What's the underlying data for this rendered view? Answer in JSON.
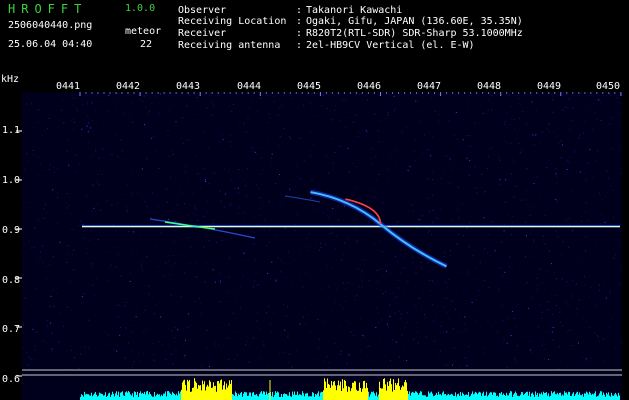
{
  "header": {
    "title": "HROFFT",
    "version": "1.0.0",
    "filename": "2506040440.png",
    "datetime": "25.06.04 04:40",
    "meteor_label": "meteor",
    "meteor_count": "22"
  },
  "info": [
    {
      "key": "Observer",
      "value": "Takanori Kawachi"
    },
    {
      "key": "Receiving Location",
      "value": "Ogaki, Gifu, JAPAN (136.60E, 35.35N)"
    },
    {
      "key": "Receiver",
      "value": "R820T2(RTL-SDR) SDR-Sharp 53.1000MHz"
    },
    {
      "key": "Receiving antenna",
      "value": "2el-HB9CV Vertical (el. E-W)"
    }
  ],
  "separator": ":",
  "chart_data": {
    "type": "heatmap",
    "ylabel": "kHz",
    "x_ticks": [
      "0441",
      "0442",
      "0443",
      "0444",
      "0445",
      "0446",
      "0447",
      "0448",
      "0449",
      "0450"
    ],
    "y_ticks": [
      "1.1",
      "1.0",
      "0.9",
      "0.8",
      "0.7",
      "0.6"
    ],
    "ylim": [
      0.58,
      1.2
    ],
    "carrier_freq_khz": 0.905,
    "meteor_trace": [
      {
        "time": "04:45.5",
        "freq_khz": 0.955
      },
      {
        "time": "04:46.0",
        "freq_khz": 0.91
      },
      {
        "time": "04:46.6",
        "freq_khz": 0.84
      }
    ],
    "reference_lines_khz": [
      0.62,
      0.61
    ]
  },
  "colors": {
    "header_text": "#3cd23c",
    "info_text": "#ffffff",
    "carrier": "#ffff80",
    "meteor": "#ff4040",
    "signal_bars": "#00ffff",
    "signal_peaks": "#ffff00",
    "background": "#000000"
  }
}
